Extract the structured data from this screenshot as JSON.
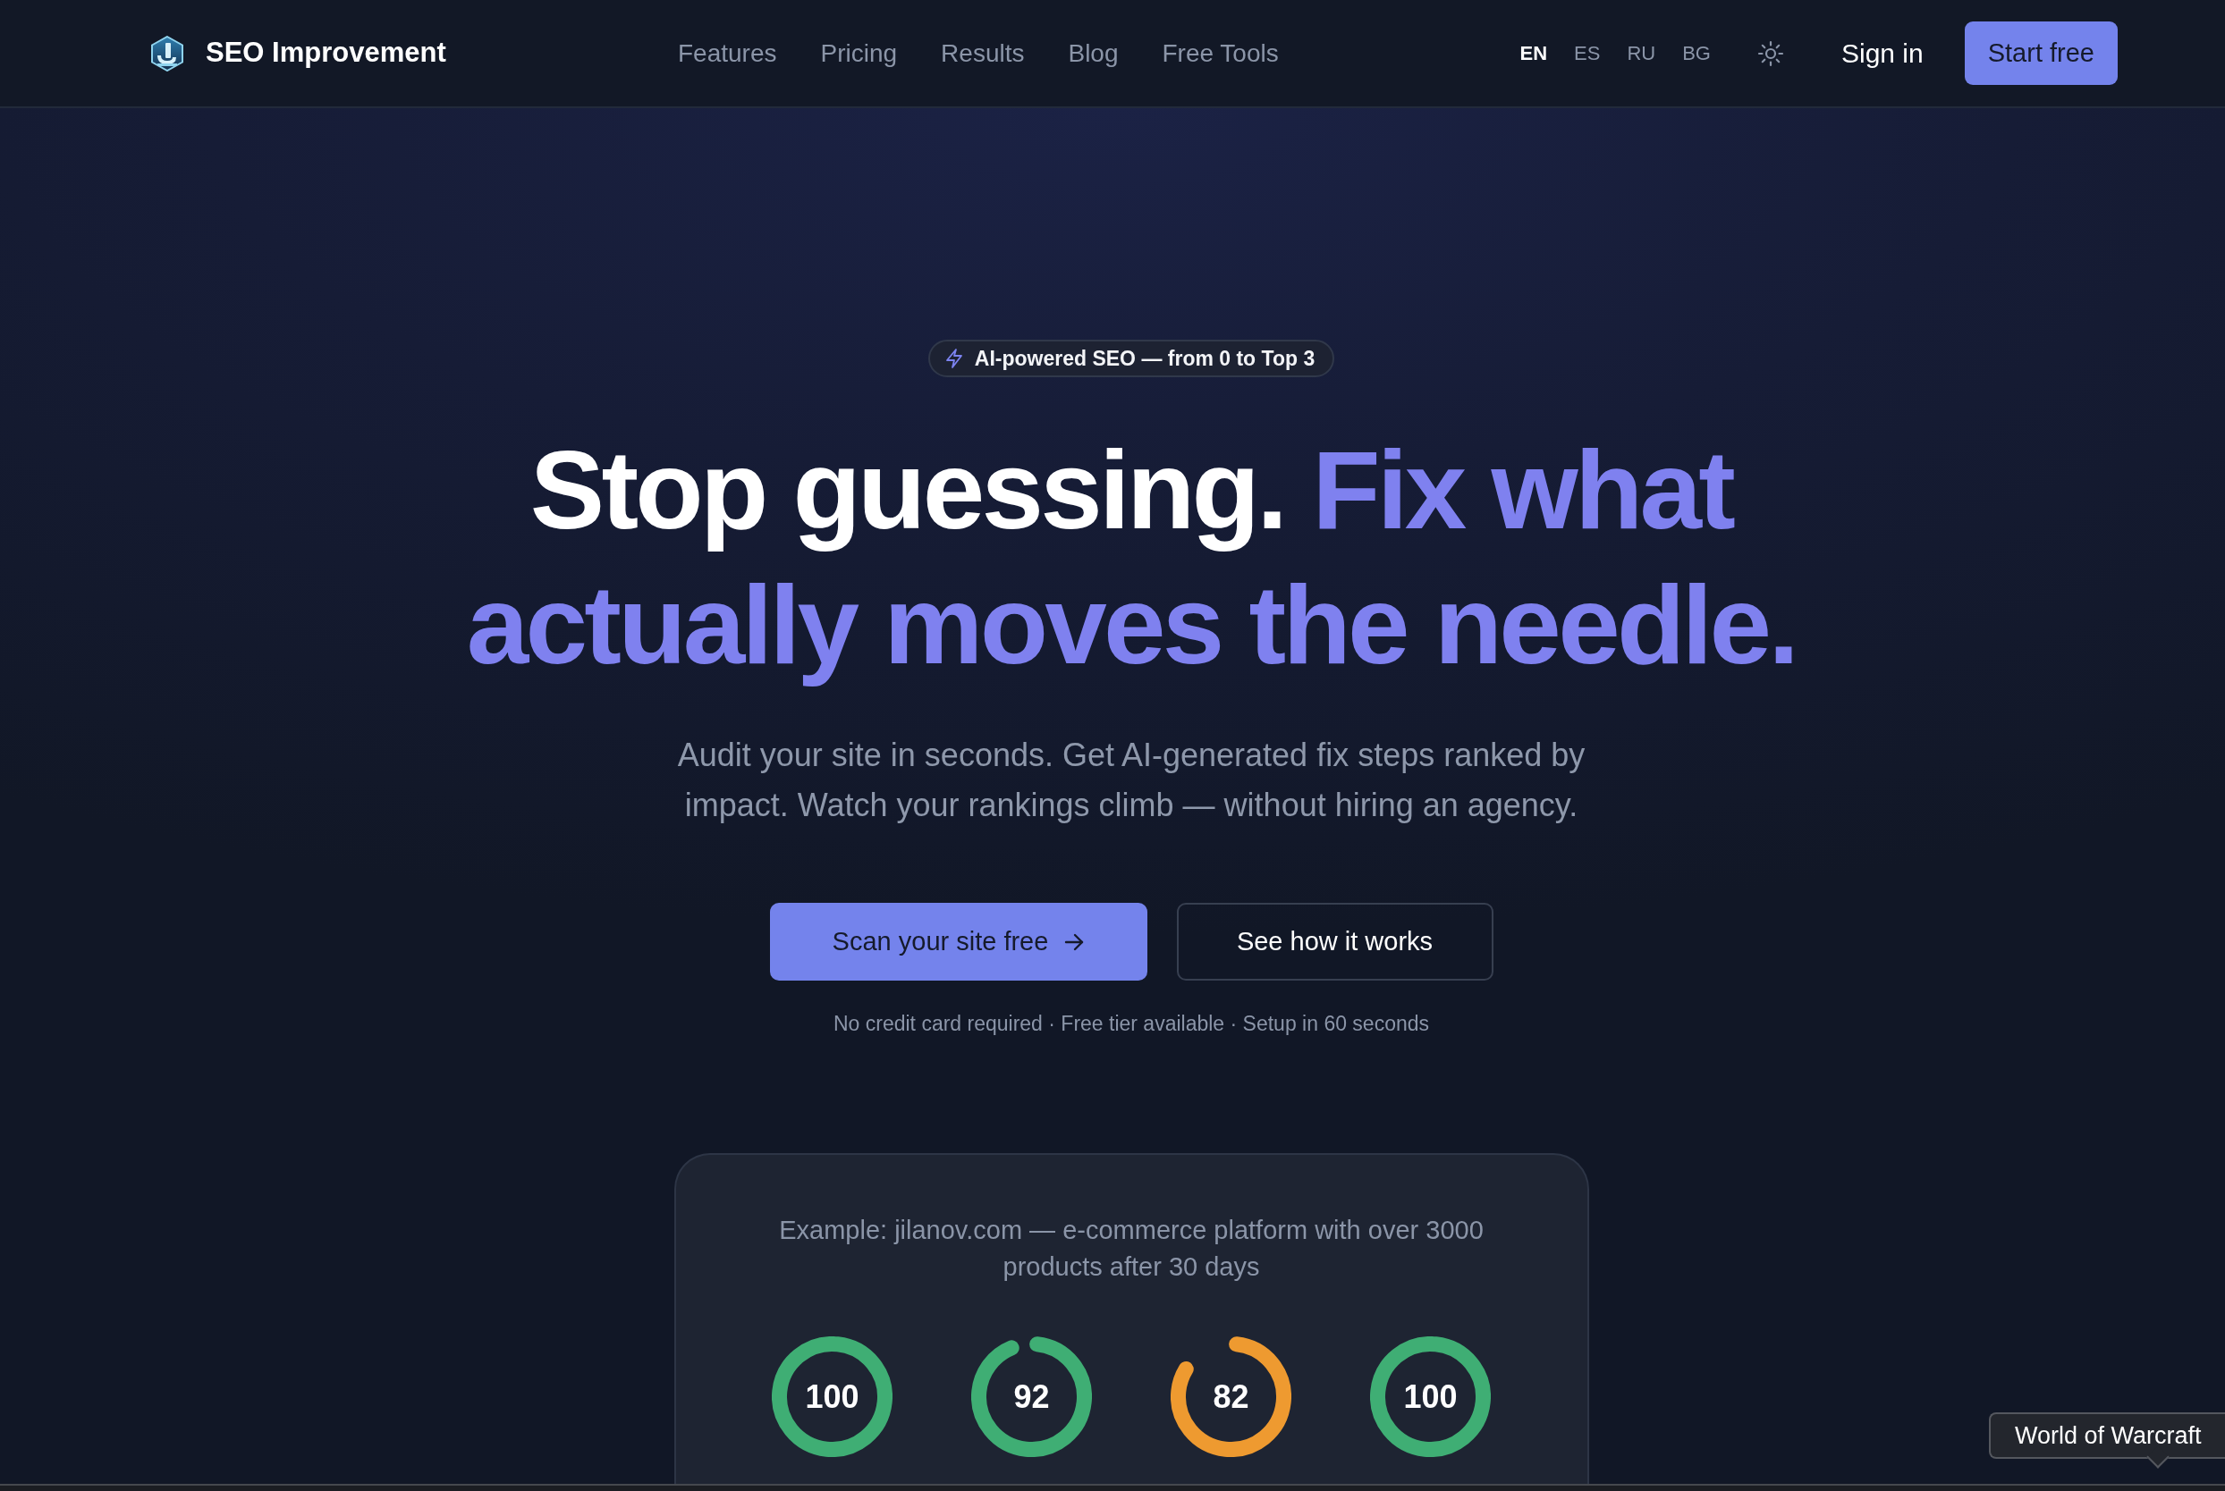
{
  "navbar": {
    "brand": "SEO Improvement",
    "links": [
      "Features",
      "Pricing",
      "Results",
      "Blog",
      "Free Tools"
    ],
    "languages": [
      {
        "code": "EN",
        "selected": true
      },
      {
        "code": "ES",
        "selected": false
      },
      {
        "code": "RU",
        "selected": false
      },
      {
        "code": "BG",
        "selected": false
      }
    ],
    "sign_in": "Sign in",
    "cta": "Start free"
  },
  "hero": {
    "badge": "AI-powered SEO — from 0 to Top 3",
    "headline": {
      "lead": "Stop guessing.",
      "highlight": "Fix what actually moves the needle."
    },
    "subtitle": "Audit your site in seconds. Get AI-generated fix steps ranked by impact. Watch your rankings climb — without hiring an agency.",
    "buttons": [
      {
        "label": "Scan your site free",
        "kind": "primary"
      },
      {
        "label": "See how it works",
        "kind": "outline"
      }
    ],
    "note": "No credit card required · Free tier available · Setup in 60 seconds"
  },
  "example": {
    "caption": "Example: jilanov.com — e-commerce platform with over 3000 products after 30 days",
    "scores": [
      {
        "value": "100",
        "level": 1,
        "color": "#3fae74"
      },
      {
        "value": "92",
        "level": 0.92,
        "color": "#3fae74"
      },
      {
        "value": "82",
        "level": 0.82,
        "color": "#ee9a30"
      },
      {
        "value": "100",
        "level": 1,
        "color": "#3fae74"
      }
    ]
  },
  "tooltip": "World of Warcraft"
}
